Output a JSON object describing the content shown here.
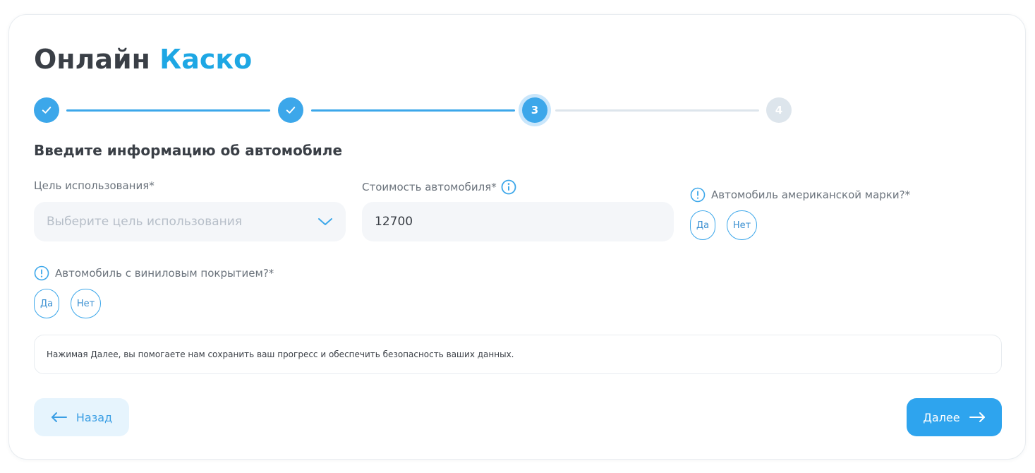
{
  "header": {
    "title_main": "Онлайн",
    "title_accent": "Каско"
  },
  "stepper": {
    "steps": [
      {
        "label": "",
        "state": "done"
      },
      {
        "label": "",
        "state": "done"
      },
      {
        "label": "3",
        "state": "active"
      },
      {
        "label": "4",
        "state": "todo"
      }
    ]
  },
  "form": {
    "section_title": "Введите информацию об автомобиле",
    "purpose": {
      "label": "Цель использования*",
      "placeholder": "Выберите цель использования"
    },
    "price": {
      "label": "Стоимость автомобиля*",
      "value": "12700"
    },
    "american_brand": {
      "label": "Автомобиль американской марки?*",
      "yes": "Да",
      "no": "Нет"
    },
    "vinyl": {
      "label": "Автомобиль с виниловым покрытием?*",
      "yes": "Да",
      "no": "Нет"
    }
  },
  "notice": {
    "text": "Нажимая Далее, вы помогаете нам сохранить ваш прогресс и обеспечить безопасность ваших данных."
  },
  "nav": {
    "back_label": "Назад",
    "next_label": "Далее"
  },
  "colors": {
    "accent": "#1ea7e4",
    "primary": "#2ea4ee",
    "text": "#3a3f46",
    "muted": "#6b737c"
  },
  "icons": {
    "check": "check-icon",
    "info": "info-icon",
    "warning": "exclamation-circle-icon",
    "chevron": "chevron-down-icon",
    "arrow_left": "arrow-left-icon",
    "arrow_right": "arrow-right-icon"
  }
}
